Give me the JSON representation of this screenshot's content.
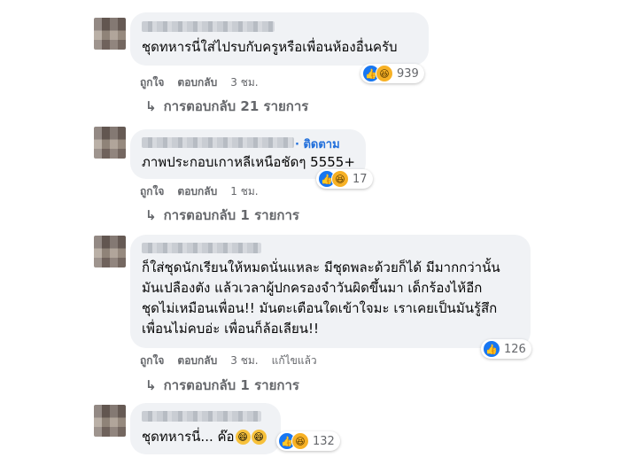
{
  "comments": [
    {
      "text_lines": [
        "ชุดทหารนี่ใส่ไปรบกับครูหรือเพื่อนห้องอื่นครับ"
      ],
      "reaction_count": "939",
      "reactions": [
        "like-icon",
        "haha-icon"
      ],
      "like_label": "ถูกใจ",
      "reply_label": "ตอบกลับ",
      "time": "3 ชม.",
      "replies_label": "การตอบกลับ 21 รายการ"
    },
    {
      "follow_label": "· ติดตาม",
      "text_lines": [
        "ภาพประกอบเกาหลีเหนือชัดๆ 5555+"
      ],
      "reaction_count": "17",
      "reactions": [
        "like-icon",
        "haha-icon"
      ],
      "like_label": "ถูกใจ",
      "reply_label": "ตอบกลับ",
      "time": "1 ชม.",
      "replies_label": "การตอบกลับ 1 รายการ"
    },
    {
      "text_lines": [
        "ก็ใส่ชุดนักเรียนให้หมดนั่นแหละ มีชุดพละด้วยก็ได้ มีมากกว่านั้น",
        "มันเปลืองตัง แล้วเวลาผู้ปกครองจำวันผิดขึ้นมา เด็กร้องไห้อีก",
        "ชุดไม่เหมือนเพื่อน!! มันตะเตือนใดเข้าใจมะ เราเคยเป็นมันรู้สึก",
        "เพื่อนไม่คบอ่ะ เพื่อนก็ล้อเลียน!!"
      ],
      "reaction_count": "126",
      "reactions": [
        "like-icon"
      ],
      "like_label": "ถูกใจ",
      "reply_label": "ตอบกลับ",
      "time": "3 ชม.",
      "edited_label": "แก้ไขแล้ว",
      "replies_label": "การตอบกลับ 1 รายการ"
    },
    {
      "text_lines": [
        "ชุดทหารนี่... ค๊อ"
      ],
      "emojis": [
        "grin-emoji",
        "grin-emoji"
      ],
      "reaction_count": "132",
      "reactions": [
        "like-icon",
        "haha-icon"
      ]
    }
  ],
  "colors": {
    "bubble": "#f0f2f5",
    "like": "#1877f2",
    "link": "#216fdb",
    "meta": "#65676b"
  }
}
